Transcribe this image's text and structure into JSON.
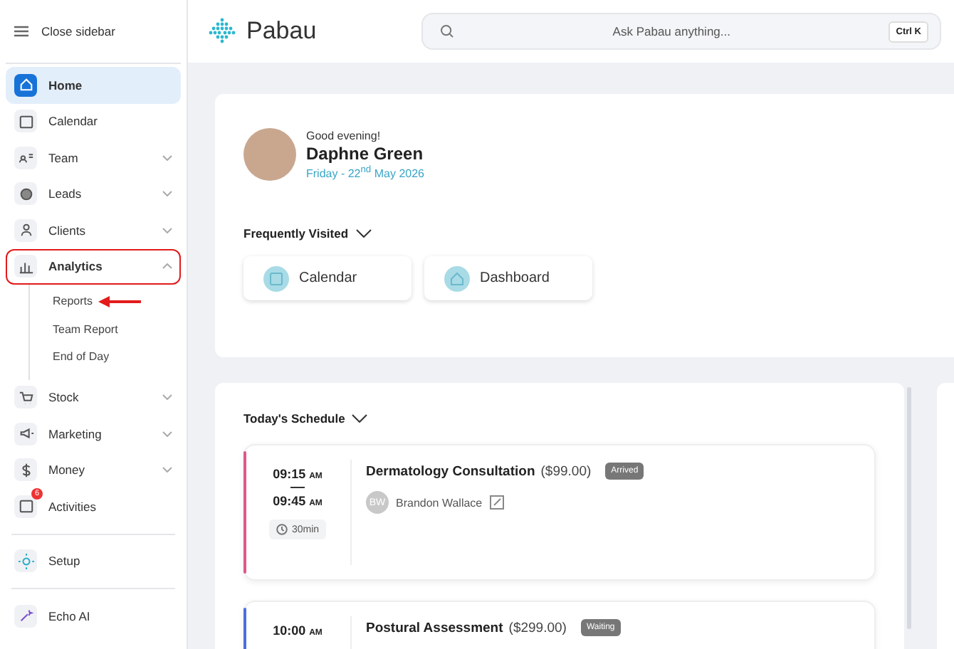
{
  "sidebar": {
    "toggle_label": "Close sidebar",
    "sections": [
      [
        {
          "label": "Home",
          "selected": true,
          "highlighted": false
        },
        {
          "label": "Calendar",
          "selected": false,
          "highlighted": false
        },
        {
          "label": "Team",
          "selected": false,
          "highlighted": false,
          "expanded": false
        },
        {
          "label": "Leads",
          "selected": false,
          "highlighted": false,
          "expanded": false
        },
        {
          "label": "Clients",
          "selected": false,
          "highlighted": false,
          "expanded": false
        },
        {
          "label": "Analytics",
          "selected": false,
          "highlighted": true,
          "expanded": true,
          "children": [
            {
              "label": "Reports",
              "pointed": true
            },
            {
              "label": "Team Report",
              "pointed": false
            },
            {
              "label": "End of Day",
              "pointed": false
            }
          ]
        },
        {
          "label": "Stock",
          "selected": false,
          "highlighted": false,
          "expanded": false
        },
        {
          "label": "Marketing",
          "selected": false,
          "highlighted": false,
          "expanded": false
        },
        {
          "label": "Money",
          "selected": false,
          "highlighted": false,
          "expanded": false
        },
        {
          "label": "Activities",
          "selected": false,
          "highlighted": false,
          "badge": "6"
        }
      ],
      [
        {
          "label": "Setup",
          "selected": false,
          "highlighted": false
        }
      ],
      [
        {
          "label": "Echo AI",
          "selected": false,
          "highlighted": false
        }
      ]
    ]
  },
  "header": {
    "logo": "Pabau",
    "search": {
      "placeholder": "Ask Pabau anything...",
      "shortcut": "Ctrl K"
    }
  },
  "welcome": {
    "greeting": "Good evening!",
    "name": "Daphne Green",
    "date": "Friday - 22$^{nd}$ May 2026"
  },
  "frequently_visited": {
    "title": "Frequently Visited",
    "items": [
      {
        "label": "Calendar"
      },
      {
        "label": "Dashboard"
      }
    ]
  },
  "schedule": {
    "title": "Today's Schedule",
    "appointments": [
      {
        "start": "09:15",
        "start_period": "AM",
        "end": "09:45",
        "end_period": "AM",
        "duration": "30min",
        "title": "Dermatology Consultation",
        "price": "($99.00)",
        "status": "Arrived",
        "client_initials": "BW",
        "client": "Brandon Wallace",
        "color": "#e0578a"
      },
      {
        "start": "10:00",
        "start_period": "AM",
        "title": "Postural Assessment",
        "price": "($299.00)",
        "status": "Waiting",
        "color": "#4a6fe0"
      }
    ]
  }
}
